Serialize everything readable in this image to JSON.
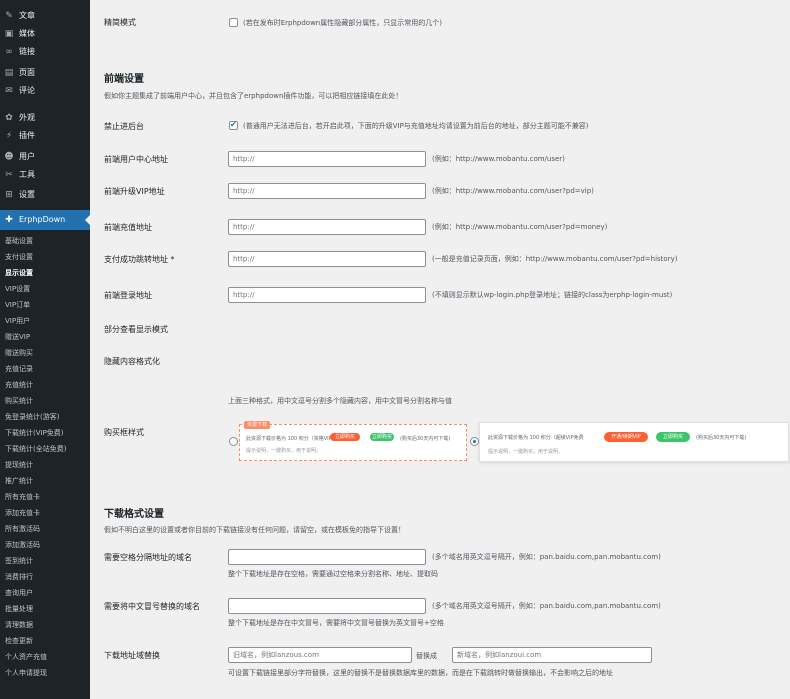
{
  "sidebar": {
    "menu": [
      {
        "icon": "post-icon",
        "glyph": "✎",
        "label": "文章"
      },
      {
        "icon": "media-icon",
        "glyph": "▣",
        "label": "媒体"
      },
      {
        "icon": "links-icon",
        "glyph": "∞",
        "label": "链接"
      },
      {
        "icon": "page-icon",
        "glyph": "▤",
        "label": "页面"
      },
      {
        "icon": "comment-icon",
        "glyph": "✉",
        "label": "评论"
      },
      {
        "icon": "appearance-icon",
        "glyph": "✿",
        "label": "外观"
      },
      {
        "icon": "plugin-icon",
        "glyph": "⚡",
        "label": "插件"
      },
      {
        "icon": "users-icon",
        "glyph": "☻",
        "label": "用户"
      },
      {
        "icon": "tools-icon",
        "glyph": "✂",
        "label": "工具"
      },
      {
        "icon": "settings-icon",
        "glyph": "⊞",
        "label": "设置"
      }
    ],
    "active": {
      "icon": "erphpdown-icon",
      "glyph": "✚",
      "label": "ErphpDown"
    },
    "submenu": [
      "基础设置",
      "支付设置",
      "显示设置",
      "VIP设置",
      "VIP订单",
      "VIP用户",
      "赠送VIP",
      "赠送购买",
      "充值记录",
      "充值统计",
      "购买统计",
      "免登录统计(游客)",
      "下载统计(VIP免费)",
      "下载统计(全站免费)",
      "提现统计",
      "推广统计",
      "所有充值卡",
      "添加充值卡",
      "所有激活码",
      "添加激活码",
      "签到统计",
      "消费排行",
      "查询用户",
      "批量处理",
      "清理数据",
      "检查更新",
      "个人资产充值",
      "个人申请提现"
    ],
    "current_submenu": "显示设置"
  },
  "content": {
    "top_row": {
      "label": "精简模式",
      "desc": "(若在发布时Erphpdown属性隐藏部分属性，只显示常用的几个)"
    },
    "frontend": {
      "title": "前端设置",
      "intro": "假如你主题集成了前端用户中心，并且包含了erphpdown插件功能，可以把相应链接填在此处！",
      "disable_admin": {
        "label": "禁止进后台",
        "desc": "(普通用户无法进后台，若开启此项，下面的升级VIP与充值地址均请设置为前后台的地址，部分主题可能不兼容)"
      },
      "fields": [
        {
          "label": "前端用户中心地址",
          "placeholder": "http://",
          "hint": "(例如：http://www.mobantu.com/user)"
        },
        {
          "label": "前端升级VIP地址",
          "placeholder": "http://",
          "hint": "(例如：http://www.mobantu.com/user?pd=vip)"
        },
        {
          "label": "前端充值地址",
          "placeholder": "http://",
          "hint": "(例如：http://www.mobantu.com/user?pd=money)"
        },
        {
          "label": "支付成功跳转地址 *",
          "placeholder": "http://",
          "hint": "(一般是充值记录页面，例如：http://www.mobantu.com/user?pd=history)"
        },
        {
          "label": "前端登录地址",
          "placeholder": "http://",
          "hint": "(不填则显示默认wp-login.php登录地址；链接的class为erphp-login-must)"
        }
      ],
      "partial_label": "部分查看显示模式",
      "hidden_label": "隐藏内容格式化",
      "hidden_desc": "上面三种格式，用中文逗号分割多个隐藏内容，用中文冒号分割名称与值",
      "purchase_label": "购买框样式",
      "style1": {
        "title": "资源下载",
        "line": "此资源下载价格为 100 积分（资格VIP免费",
        "btn_orange": "立即购买",
        "btn_green": "立即购买",
        "note": "(购买后30天内可下载)",
        "sub": "提示说明，一键购买，用于说明。"
      },
      "style2": {
        "line": "此资源下载价格为 100 积分（超级VIP免费",
        "btn_orange": "开通/续期VIP",
        "btn_green": "立即购买",
        "note": "(购买后30天内可下载)",
        "sub": "提示说明，一键购买，用于说明。"
      }
    },
    "download": {
      "title": "下载格式设置",
      "intro": "假如不明白这里的设置或者你目前的下载链接没有任何问题，请留空，或在模板免的指导下设置！",
      "fields": [
        {
          "label": "需要空格分隔地址的域名",
          "hint": "(多个域名用英文逗号隔开，例如：pan.baidu.com,pan.mobantu.com)",
          "desc": "整个下载地址是存在空格，需要通过空格来分割名称、地址、提取码"
        },
        {
          "label": "需要将中文冒号替换的域名",
          "hint": "(多个域名用英文逗号隔开，例如：pan.baidu.com,pan.mobantu.com)",
          "desc": "整个下载地址是存在中文冒号，需要将中文冒号替换为英文冒号+空格"
        }
      ],
      "replace": {
        "label": "下载地址域替换",
        "old_placeholder": "旧域名，例如lanzous.com",
        "to": "替换成",
        "new_placeholder": "新域名，例如lanzoui.com",
        "desc": "可设置下载链接里部分字符替换，这里的替换不是替换数据库里的数据，而是在下载跳转时做替换输出，不会影响之后的地址"
      }
    }
  },
  "colors": {
    "accent": "#2271b1",
    "orange": "#ff5f33",
    "green": "#3cc56b",
    "price": "#ff5f33"
  }
}
